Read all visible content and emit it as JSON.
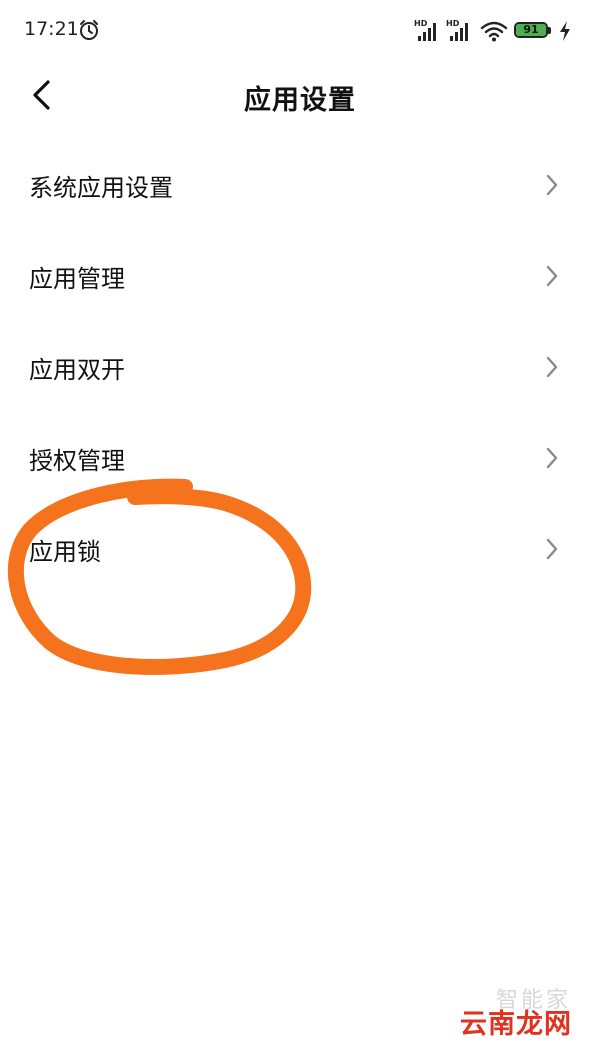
{
  "status_bar": {
    "time": "17:21",
    "signal_1_label": "HD",
    "signal_2_label": "HD",
    "battery_level": "91",
    "battery_color": "#4caf50",
    "icons": [
      "alarm-icon",
      "signal-icon",
      "signal-icon",
      "wifi-icon",
      "battery-icon",
      "charging-icon"
    ]
  },
  "header": {
    "title": "应用设置",
    "back_icon": "chevron-left-icon"
  },
  "menu": {
    "items": [
      {
        "label": "系统应用设置"
      },
      {
        "label": "应用管理"
      },
      {
        "label": "应用双开"
      },
      {
        "label": "授权管理"
      },
      {
        "label": "应用锁"
      }
    ],
    "chevron_icon": "chevron-right-icon"
  },
  "annotation": {
    "color": "#f5731c",
    "circled_item": "应用锁"
  },
  "watermark": {
    "top_text": "智能家",
    "bottom_text": "云南龙网",
    "bottom_color": "#e0321e"
  }
}
